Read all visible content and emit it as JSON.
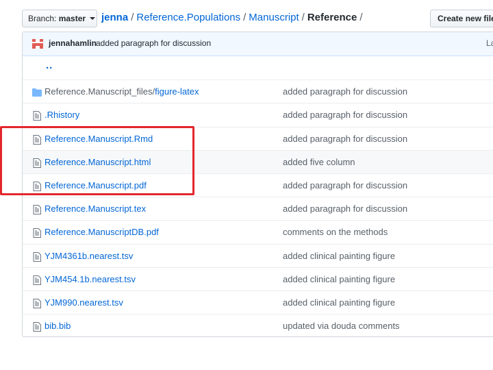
{
  "header": {
    "branch_label": "Branch:",
    "branch_value": "master",
    "breadcrumb": {
      "repo": "jenna",
      "sep1": "/",
      "path1": "Reference.Populations",
      "sep2": "/",
      "path2": "Manuscript",
      "sep3": "/",
      "current": "Reference",
      "sep4": "/"
    },
    "create_button": "Create new file"
  },
  "commit": {
    "author": "jennahamlin",
    "message": "added paragraph for discussion",
    "latest_label": "La"
  },
  "parent_dir": "..",
  "rows": [
    {
      "type": "dir",
      "prefix": "Reference.Manuscript_files/",
      "name": "figure-latex",
      "message": "added paragraph for discussion",
      "icon": "folder-icon"
    },
    {
      "type": "file",
      "name": ".Rhistory",
      "message": "added paragraph for discussion",
      "icon": "file-icon"
    },
    {
      "type": "file",
      "name": "Reference.Manuscript.Rmd",
      "message": "added paragraph for discussion",
      "icon": "file-icon"
    },
    {
      "type": "file",
      "name": "Reference.Manuscript.html",
      "message": "added five column",
      "icon": "file-icon"
    },
    {
      "type": "file",
      "name": "Reference.Manuscript.pdf",
      "message": "added paragraph for discussion",
      "icon": "file-icon"
    },
    {
      "type": "file",
      "name": "Reference.Manuscript.tex",
      "message": "added paragraph for discussion",
      "icon": "file-icon"
    },
    {
      "type": "file",
      "name": "Reference.ManuscriptDB.pdf",
      "message": "comments on the methods",
      "icon": "file-icon"
    },
    {
      "type": "file",
      "name": "YJM4361b.nearest.tsv",
      "message": "added clinical painting figure",
      "icon": "file-icon"
    },
    {
      "type": "file",
      "name": "YJM454.1b.nearest.tsv",
      "message": "added clinical painting figure",
      "icon": "file-icon"
    },
    {
      "type": "file",
      "name": "YJM990.nearest.tsv",
      "message": "added clinical painting figure",
      "icon": "file-icon"
    },
    {
      "type": "file",
      "name": "bib.bib",
      "message": "updated via douda comments",
      "icon": "file-icon"
    }
  ],
  "colors": {
    "link": "#0366d6",
    "highlight_box": "#e3262d",
    "commit_bar": "#f1f8ff"
  }
}
